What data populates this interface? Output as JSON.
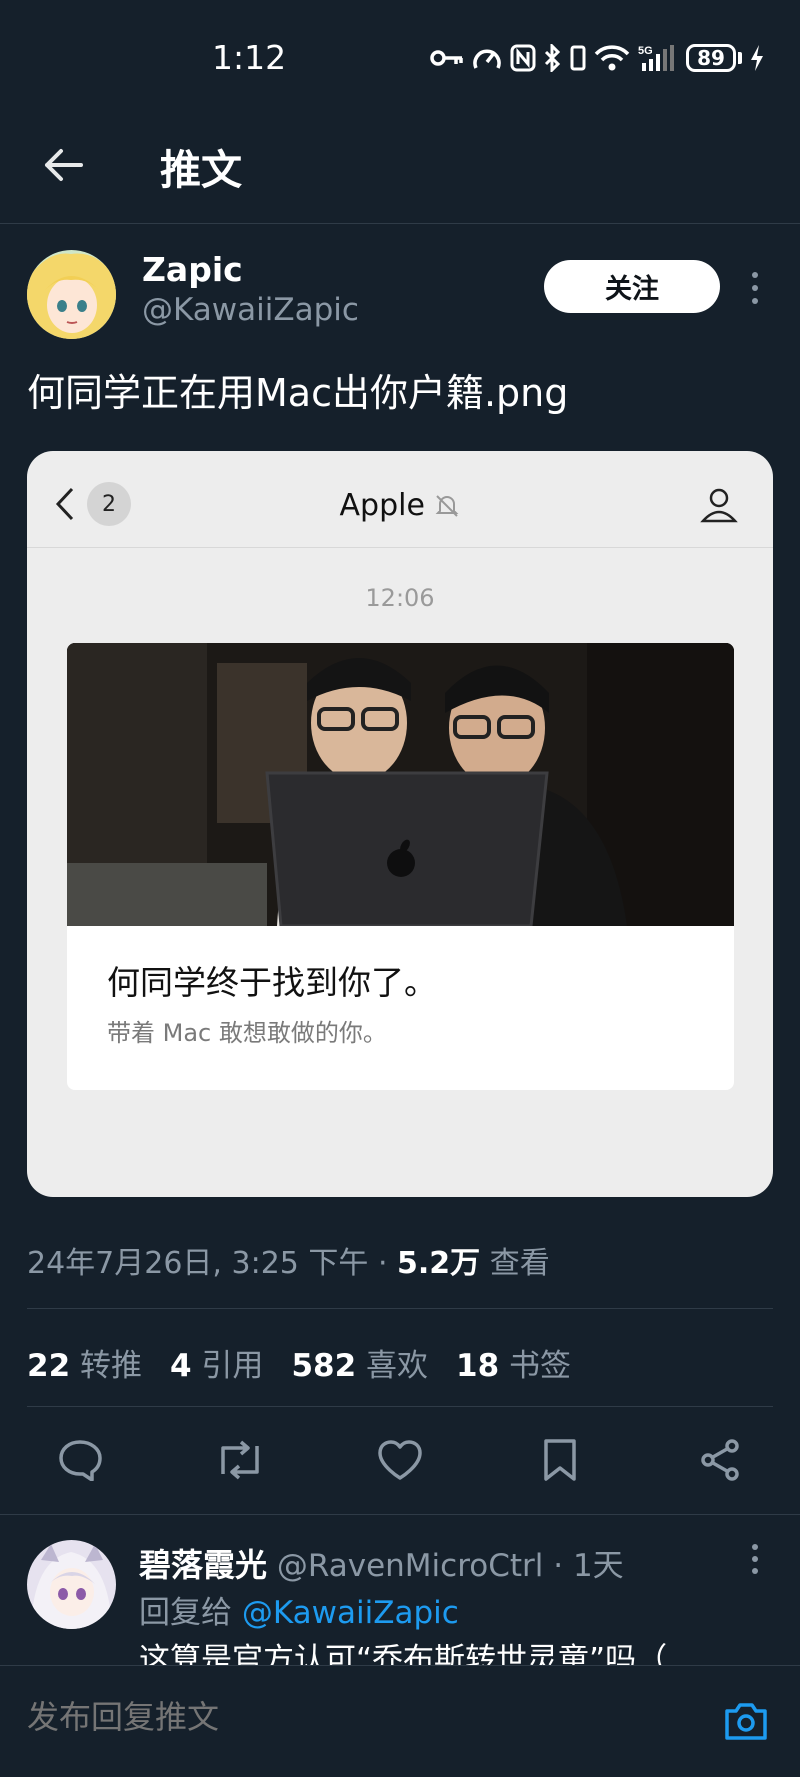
{
  "status_bar": {
    "time": "1:12",
    "battery": "89",
    "network": "5G"
  },
  "header": {
    "title": "推文"
  },
  "tweet": {
    "author_name": "Zapic",
    "author_handle": "@KawaiiZapic",
    "follow_label": "关注",
    "text": "何同学正在用Mac出你户籍.png",
    "card": {
      "badge": "2",
      "title": "Apple",
      "time": "12:06",
      "message_title": "何同学终于找到你了。",
      "message_subtitle": "带着 Mac 敢想敢做的你。"
    },
    "date": "24年7月26日, 3:25 下午 · ",
    "views": "5.2万",
    "views_label": " 查看",
    "stats": [
      {
        "count": "22",
        "label": " 转推"
      },
      {
        "count": "4",
        "label": " 引用"
      },
      {
        "count": "582",
        "label": " 喜欢"
      },
      {
        "count": "18",
        "label": " 书签"
      }
    ]
  },
  "reply": {
    "name": "碧落霞光",
    "handle_time": " @RavenMicroCtrl · 1天",
    "reply_to_prefix": "回复给 ",
    "reply_to_handle": "@KawaiiZapic",
    "text": "这算是官方认可“乔布斯转世灵童”吗（"
  },
  "compose": {
    "placeholder": "发布回复推文"
  },
  "colors": {
    "background": "#15202b",
    "accent": "#1d9bf0",
    "muted": "#8b98a5"
  }
}
